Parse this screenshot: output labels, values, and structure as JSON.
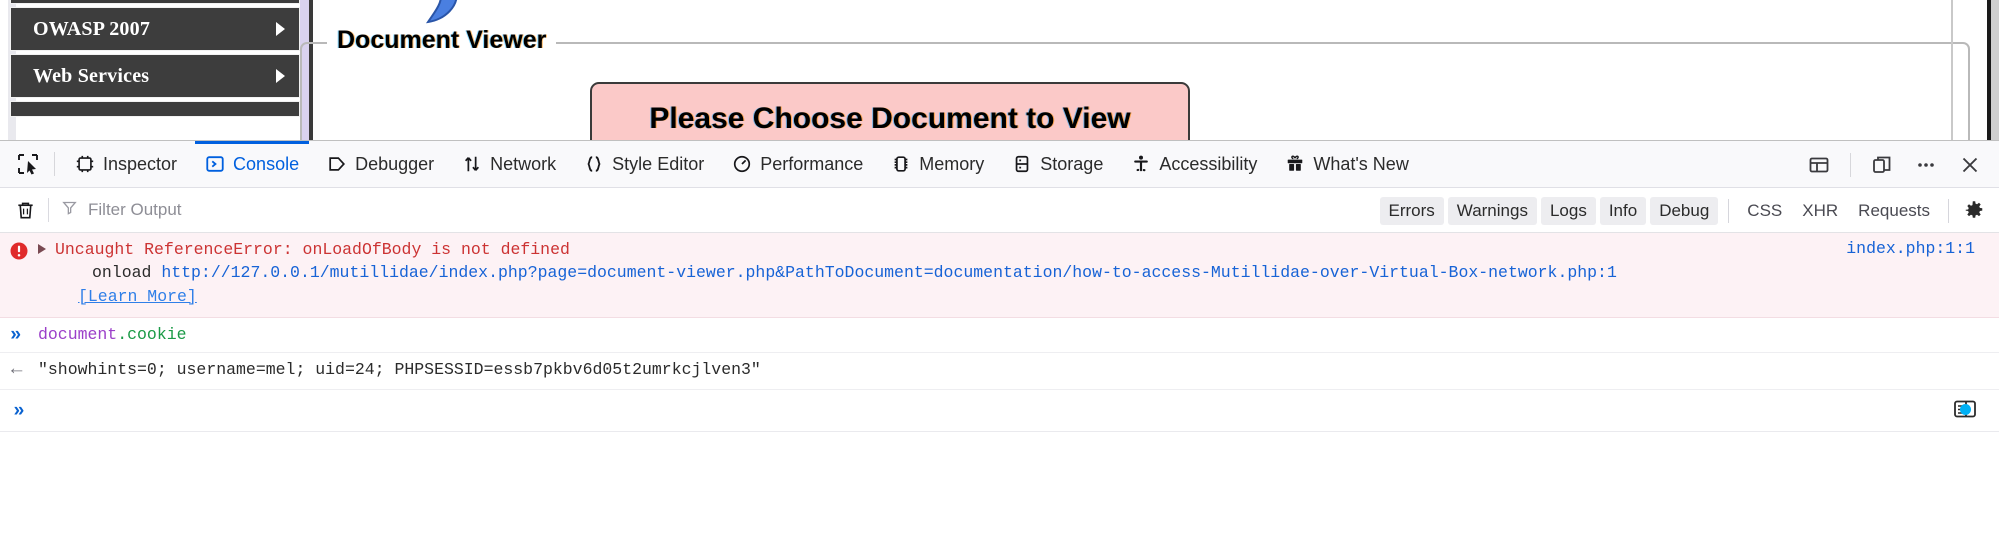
{
  "page": {
    "menu_items": [
      {
        "label": "OWASP 2007",
        "icon": "chevron-right-icon"
      },
      {
        "label": "Web Services",
        "icon": "chevron-right-icon"
      }
    ],
    "fieldset_legend": "Document Viewer",
    "choose_banner": "Please Choose Document to View"
  },
  "devtools": {
    "picker_icon": "element-picker-icon",
    "tabs": [
      {
        "label": "Inspector",
        "icon": "inspector-icon",
        "active": false
      },
      {
        "label": "Console",
        "icon": "console-icon",
        "active": true
      },
      {
        "label": "Debugger",
        "icon": "debugger-icon",
        "active": false
      },
      {
        "label": "Network",
        "icon": "network-icon",
        "active": false
      },
      {
        "label": "Style Editor",
        "icon": "style-editor-icon",
        "active": false
      },
      {
        "label": "Performance",
        "icon": "performance-icon",
        "active": false
      },
      {
        "label": "Memory",
        "icon": "memory-icon",
        "active": false
      },
      {
        "label": "Storage",
        "icon": "storage-icon",
        "active": false
      },
      {
        "label": "Accessibility",
        "icon": "accessibility-icon",
        "active": false
      },
      {
        "label": "What's New",
        "icon": "whats-new-gift-icon",
        "active": false
      }
    ],
    "toolbar_buttons": [
      {
        "name": "responsive-layout-icon"
      },
      {
        "name": "split-window-icon"
      },
      {
        "name": "meatball-menu-icon"
      },
      {
        "name": "close-icon"
      }
    ],
    "filterbar": {
      "trash_icon": "trash-icon",
      "filter_icon": "funnel-icon",
      "filter_value": "",
      "filter_placeholder": "Filter Output",
      "toggles": [
        "Errors",
        "Warnings",
        "Logs",
        "Info",
        "Debug"
      ],
      "plain_filters": [
        "CSS",
        "XHR",
        "Requests"
      ],
      "settings_icon": "gear-icon"
    },
    "console": {
      "error": {
        "icon": "error-circle-icon",
        "title": "Uncaught ReferenceError: onLoadOfBody is not defined",
        "stack_label": "onload",
        "stack_url": "http://127.0.0.1/mutillidae/index.php?page=document-viewer.php&PathToDocument=documentation/how-to-access-Mutillidae-over-Virtual-Box-network.php:1",
        "learn_more": "[Learn More]",
        "source": "index.php:1:1"
      },
      "input": {
        "chevron": "»",
        "object": "document",
        "property": ".cookie"
      },
      "result": {
        "arrow": "←",
        "value": "\"showhints=0; username=mel; uid=24; PHPSESSID=essb7pkbv6d05t2umrkcjlven3\""
      },
      "prompt": {
        "chevron": "»",
        "value": "",
        "split_icon": "split-console-icon"
      }
    },
    "colors": {
      "accent": "#0060df",
      "error_text": "#cc3333",
      "error_bg": "#fdf2f5",
      "link": "#1763d6",
      "badge": "#00b0f4"
    }
  }
}
